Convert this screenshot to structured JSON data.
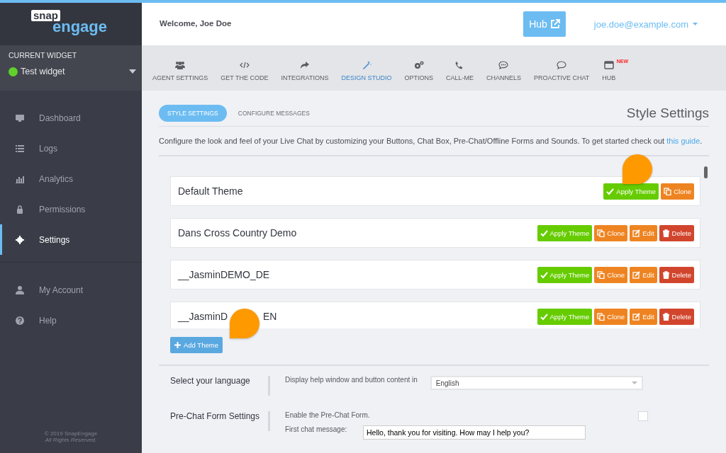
{
  "logo": {
    "top": "snap",
    "bottom": "engage"
  },
  "widget": {
    "heading": "CURRENT WIDGET",
    "name": "Test widget",
    "color": "#5fd12a"
  },
  "sidebar": {
    "items": [
      {
        "label": "Dashboard",
        "selected": false
      },
      {
        "label": "Logs",
        "selected": false
      },
      {
        "label": "Analytics",
        "selected": false
      },
      {
        "label": "Permissions",
        "selected": false
      },
      {
        "label": "Settings",
        "selected": true
      }
    ],
    "account_items": [
      {
        "label": "My Account",
        "selected": false
      },
      {
        "label": "Help",
        "selected": false
      }
    ],
    "footer": {
      "copyright": "© 2019 SnapEngage",
      "rights": "All Rights Reserved."
    }
  },
  "header": {
    "welcome": "Welcome, Joe Doe",
    "hub_button": "Hub",
    "user": "joe.doe@example.com"
  },
  "tabs": [
    {
      "label": "AGENT SETTINGS",
      "selected": false
    },
    {
      "label": "GET THE CODE",
      "selected": false
    },
    {
      "label": "INTEGRATIONS",
      "selected": false
    },
    {
      "label": "DESIGN STUDIO",
      "selected": true
    },
    {
      "label": "OPTIONS",
      "selected": false
    },
    {
      "label": "CALL-ME",
      "selected": false
    },
    {
      "label": "CHANNELS",
      "selected": false
    },
    {
      "label": "PROACTIVE CHAT",
      "selected": false
    },
    {
      "label": "HUB",
      "selected": false,
      "badge": "NEW"
    }
  ],
  "subtabs": [
    {
      "label": "STYLE SETTINGS",
      "selected": true
    },
    {
      "label": "CONFIGURE MESSAGES",
      "selected": false
    }
  ],
  "page_title": "Style Settings",
  "intro": {
    "text": "Configure the look and feel of your Live Chat by customizing your Buttons, Chat Box, Pre-Chat/Offline Forms and Sounds. To get started check out",
    "link": "this guide",
    "end": "."
  },
  "themes": [
    {
      "name": "Default Theme",
      "buttons": [
        {
          "kind": "apply",
          "label": "Apply Theme"
        },
        {
          "kind": "clone",
          "label": "Clone"
        }
      ]
    },
    {
      "name": "Dans Cross Country Demo",
      "buttons": [
        {
          "kind": "apply",
          "label": "Apply Theme"
        },
        {
          "kind": "clone",
          "label": "Clone"
        },
        {
          "kind": "edit",
          "label": "Edit"
        },
        {
          "kind": "delete",
          "label": "Delete"
        }
      ]
    },
    {
      "name": "__JasminDEMO_DE",
      "buttons": [
        {
          "kind": "apply",
          "label": "Apply Theme"
        },
        {
          "kind": "clone",
          "label": "Clone"
        },
        {
          "kind": "edit",
          "label": "Edit"
        },
        {
          "kind": "delete",
          "label": "Delete"
        }
      ]
    },
    {
      "name": "__JasminD",
      "name_tail": "EN",
      "buttons": [
        {
          "kind": "apply",
          "label": "Apply Theme"
        },
        {
          "kind": "clone",
          "label": "Clone"
        },
        {
          "kind": "edit",
          "label": "Edit"
        },
        {
          "kind": "delete",
          "label": "Delete"
        }
      ]
    }
  ],
  "add_theme": "Add Theme",
  "settings": [
    {
      "kind": "select",
      "title": "Select your language",
      "description": "Display help window and button content in",
      "value": "English"
    },
    {
      "kind": "checkbox",
      "title": "Pre-Chat Form Settings",
      "description": "Enable the Pre-Chat Form.",
      "checked": false,
      "field_label": "First chat message:",
      "field_value": "Hello, thank you for visiting. How may I help you?"
    }
  ]
}
